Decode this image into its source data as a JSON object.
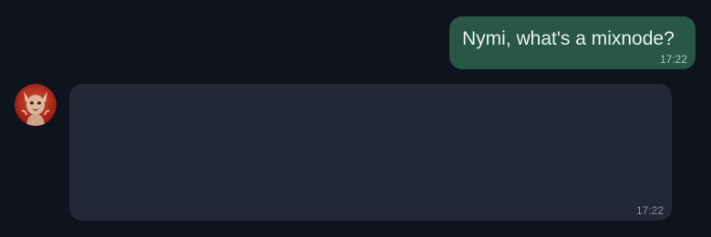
{
  "messages": [
    {
      "role": "user",
      "text": "Nymi, what's a mixnode?",
      "time": "17:22"
    },
    {
      "role": "assistant",
      "text": "",
      "time": "17:22",
      "avatar_icon": "creature-avatar-icon"
    }
  ],
  "colors": {
    "background": "#0e131e",
    "user_bubble": "#285748",
    "assistant_bubble": "#222834",
    "avatar_accent": "#b8321e"
  }
}
